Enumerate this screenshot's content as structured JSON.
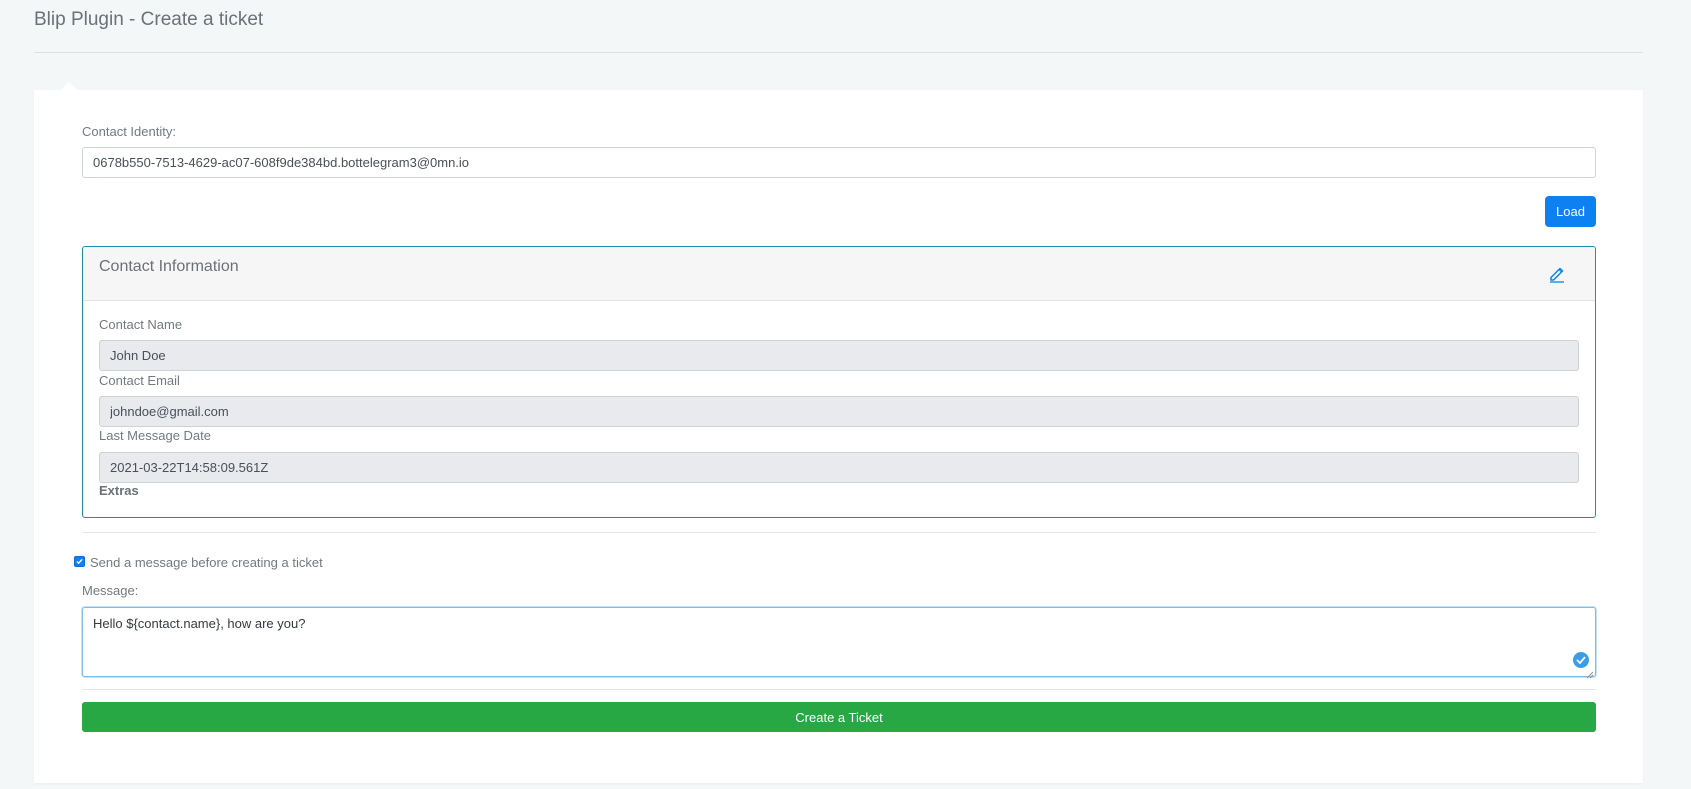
{
  "header": {
    "title": "Blip Plugin - Create a ticket"
  },
  "contact_identity": {
    "label": "Contact Identity:",
    "value": "0678b550-7513-4629-ac07-608f9de384bd.bottelegram3@0mn.io"
  },
  "load_button": {
    "label": "Load"
  },
  "contact_info": {
    "title": "Contact Information",
    "edit_icon": "pencil-icon",
    "fields": [
      {
        "label": "Contact Name",
        "value": "John Doe"
      },
      {
        "label": "Contact Email",
        "value": "johndoe@gmail.com"
      },
      {
        "label": "Last Message Date",
        "value": "2021-03-22T14:58:09.561Z"
      }
    ],
    "extras_label": "Extras"
  },
  "send_message": {
    "checkbox_label": "Send a message before creating a ticket",
    "checked": true,
    "message_label": "Message:",
    "message_value": "Hello ${contact.name}, how are you?"
  },
  "create_button": {
    "label": "Create a Ticket"
  },
  "colors": {
    "primary": "#0d80f2",
    "success": "#28a745",
    "panel_border": "#1b8fa7",
    "background": "#f4f7f8"
  }
}
